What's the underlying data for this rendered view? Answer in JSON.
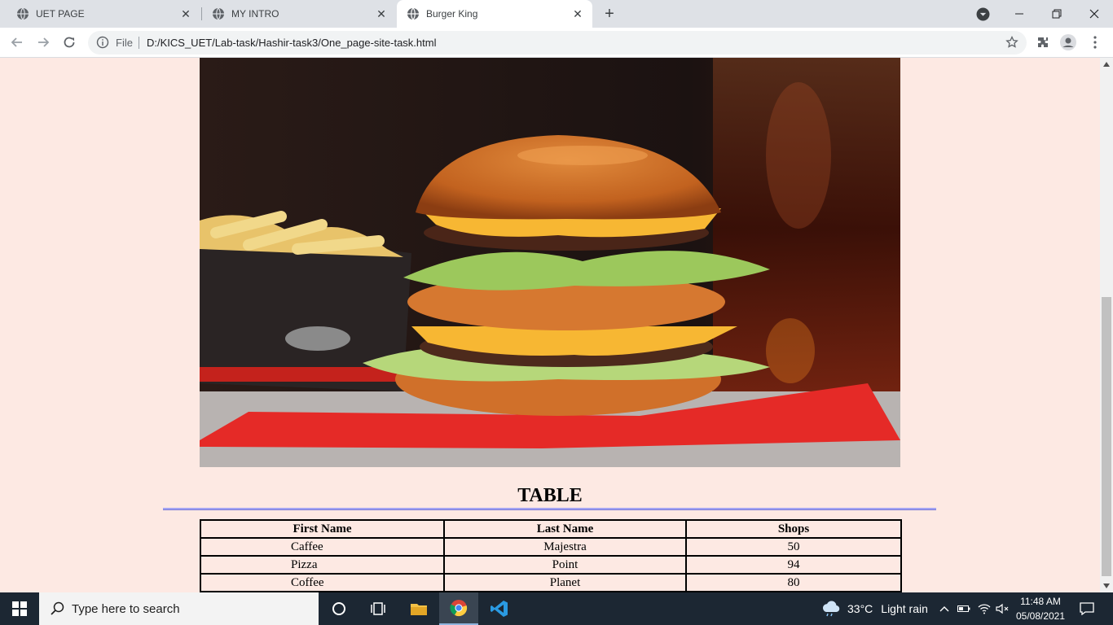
{
  "browser": {
    "tabs": [
      {
        "title": "UET PAGE",
        "active": false
      },
      {
        "title": "MY INTRO",
        "active": false
      },
      {
        "title": "Burger King",
        "active": true
      }
    ],
    "omnibox": {
      "scheme_label": "File",
      "url": "D:/KICS_UET/Lab-task/Hashir-task3/One_page-site-task.html"
    }
  },
  "page": {
    "section_title": "TABLE",
    "table": {
      "headers": [
        "First Name",
        "Last Name",
        "Shops"
      ],
      "rows": [
        [
          "Caffee",
          "Majestra",
          "50"
        ],
        [
          "Pizza",
          "Point",
          "94"
        ],
        [
          "Coffee",
          "Planet",
          "80"
        ]
      ]
    },
    "colors": {
      "page_background": "#fde9e3",
      "rule": "#a4a4f2"
    }
  },
  "taskbar": {
    "search_placeholder": "Type here to search",
    "weather": {
      "temp": "33°C",
      "condition": "Light rain"
    },
    "clock": {
      "time": "11:48 AM",
      "date": "05/08/2021"
    }
  }
}
